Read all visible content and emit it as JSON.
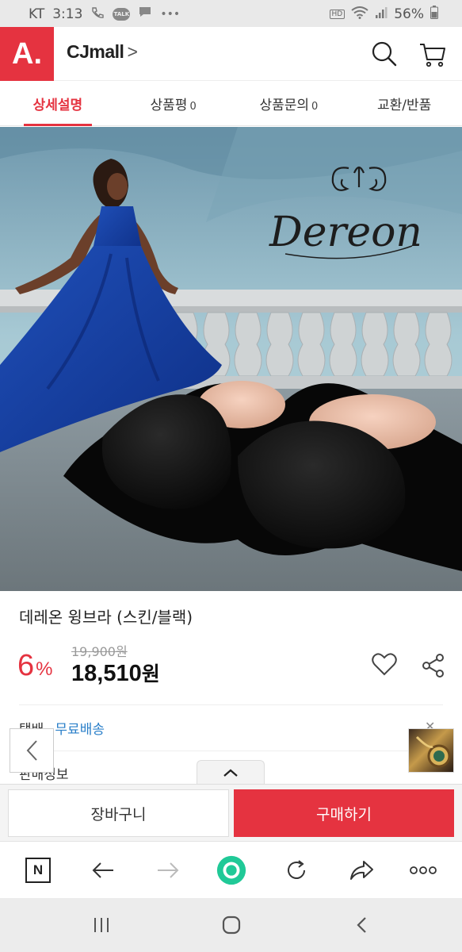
{
  "status_bar": {
    "carrier": "KT",
    "time": "3:13",
    "battery": "56%",
    "hd_label": "HD",
    "talk_label": "TALK",
    "more_glyph": "•••"
  },
  "header": {
    "logo_text": "A.",
    "mall_name": "CJmall",
    "mall_chevron": ">",
    "icons": [
      "search-icon",
      "cart-icon"
    ]
  },
  "tabs": [
    {
      "label": "상세설명",
      "count": "",
      "active": true
    },
    {
      "label": "상품평",
      "count": "0",
      "active": false
    },
    {
      "label": "상품문의",
      "count": "0",
      "active": false
    },
    {
      "label": "교환/반품",
      "count": "",
      "active": false
    }
  ],
  "hero": {
    "brand_logo": "Dereon"
  },
  "product": {
    "title": "데레온 윙브라 (스킨/블랙)",
    "original_price": "19,900원",
    "discount_number": "6",
    "discount_symbol": "%",
    "sale_price": "18,510",
    "sale_price_unit": "원"
  },
  "shipping": {
    "label": "택배",
    "dash": "-",
    "value": "무료배송"
  },
  "info_row": {
    "label": "판매정보"
  },
  "actions": {
    "cart_label": "장바구니",
    "buy_label": "구매하기"
  },
  "browser_bar": {
    "icons": [
      "n-home-icon",
      "back-arrow-icon",
      "forward-arrow-icon",
      "green-dot-icon",
      "refresh-icon",
      "share-arrow-icon",
      "more-icon"
    ],
    "n_label": "N"
  },
  "colors": {
    "brand_red": "#e53340",
    "link_blue": "#2a7fc9",
    "status_bar_bg": "#e9e9e9",
    "green_dot": "#20c997"
  }
}
